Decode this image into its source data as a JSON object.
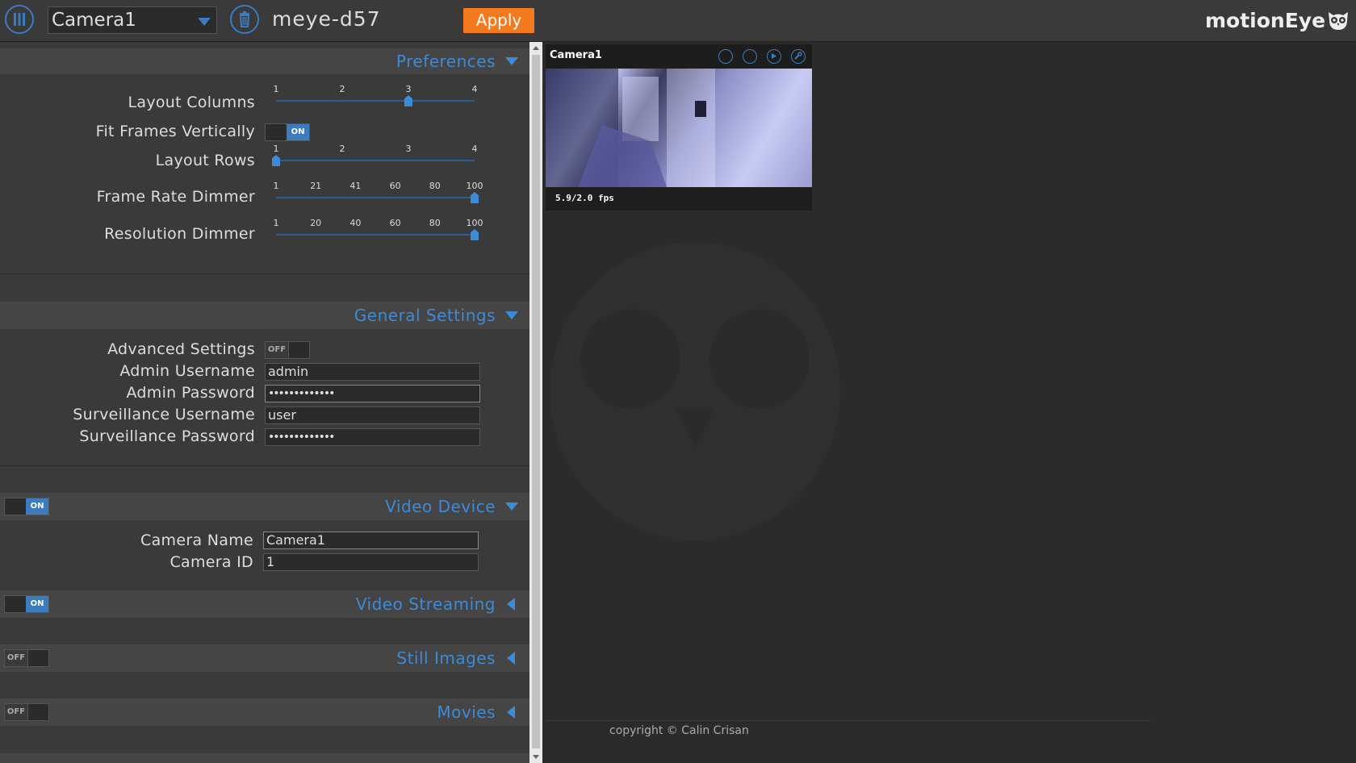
{
  "topbar": {
    "camera_select": "Camera1",
    "hostname": "meye-d57",
    "apply_label": "Apply",
    "brand": "motionEye"
  },
  "preferences": {
    "title": "Preferences",
    "layout_columns": {
      "label": "Layout Columns",
      "ticks": [
        "1",
        "2",
        "3",
        "4"
      ],
      "value": 3
    },
    "fit_frames_vertically": {
      "label": "Fit Frames Vertically",
      "state": "ON"
    },
    "layout_rows": {
      "label": "Layout Rows",
      "ticks": [
        "1",
        "2",
        "3",
        "4"
      ],
      "value": 1
    },
    "frame_rate_dimmer": {
      "label": "Frame Rate Dimmer",
      "ticks": [
        "1",
        "21",
        "41",
        "60",
        "80",
        "100"
      ],
      "value": 100
    },
    "resolution_dimmer": {
      "label": "Resolution Dimmer",
      "ticks": [
        "1",
        "20",
        "40",
        "60",
        "80",
        "100"
      ],
      "value": 100
    }
  },
  "general": {
    "title": "General Settings",
    "advanced_settings": {
      "label": "Advanced Settings",
      "state": "OFF"
    },
    "admin_username": {
      "label": "Admin Username",
      "value": "admin"
    },
    "admin_password": {
      "label": "Admin Password",
      "value": "•••••••••••••"
    },
    "surveillance_username": {
      "label": "Surveillance Username",
      "value": "user"
    },
    "surveillance_password": {
      "label": "Surveillance Password",
      "value": "•••••••••••••"
    }
  },
  "video_device": {
    "title": "Video Device",
    "state": "ON",
    "camera_name": {
      "label": "Camera Name",
      "value": "Camera1"
    },
    "camera_id": {
      "label": "Camera ID",
      "value": "1"
    }
  },
  "video_streaming": {
    "title": "Video Streaming",
    "state": "ON"
  },
  "still_images": {
    "title": "Still Images",
    "state": "OFF"
  },
  "movies": {
    "title": "Movies",
    "state": "OFF"
  },
  "camera_view": {
    "title": "Camera1",
    "fps": "5.9/2.0 fps",
    "icons": [
      "fullscreen-icon",
      "picture-icon",
      "play-icon",
      "wrench-icon"
    ]
  },
  "footer": {
    "copyright": "copyright © Calin Crisan"
  },
  "colors": {
    "accent": "#3b8bd9",
    "apply": "#f47a20",
    "panel": "#3a3a3a",
    "background": "#2b2b2b"
  }
}
